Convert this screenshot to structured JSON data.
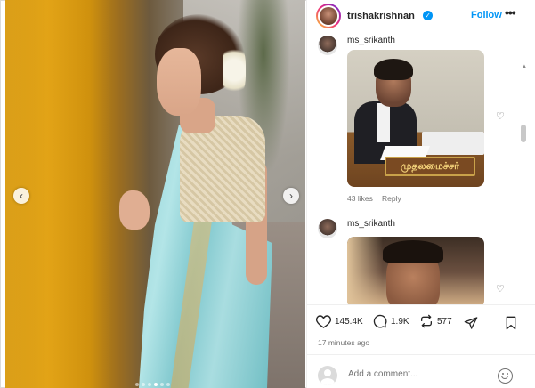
{
  "post": {
    "carousel": {
      "slide_count": 6,
      "active_index": 3,
      "prev_icon": "chevron-left-icon",
      "next_icon": "chevron-right-icon",
      "prev_glyph": "‹",
      "next_glyph": "›"
    }
  },
  "header": {
    "username": "trishakrishnan",
    "verified_glyph": "✓",
    "follow_label": "Follow",
    "more_glyph": "•••"
  },
  "comments": [
    {
      "user": "ms_srikanth",
      "image_caption": "முதலமைச்சர்",
      "likes": "43 likes",
      "reply_label": "Reply"
    },
    {
      "user": "ms_srikanth"
    }
  ],
  "actions": {
    "likes": "145.4K",
    "comments": "1.9K",
    "shares": "577",
    "posted": "17 minutes ago"
  },
  "add_comment": {
    "placeholder": "Add a comment..."
  },
  "colors": {
    "accent": "#0095f6",
    "text": "#262626",
    "muted": "#737373"
  }
}
